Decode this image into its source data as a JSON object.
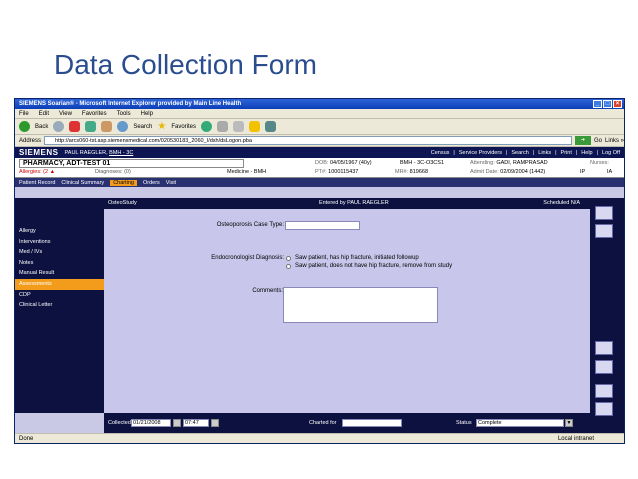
{
  "slide": {
    "title": "Data Collection Form"
  },
  "window": {
    "title": "SIEMENS Soarian® - Microsoft Internet Explorer provided by Main Line Health",
    "menu": [
      "File",
      "Edit",
      "View",
      "Favorites",
      "Tools",
      "Help"
    ],
    "toolbar": {
      "back": "Back",
      "search": "Search",
      "favorites": "Favorites"
    },
    "address_label": "Address",
    "address_url": "http://arcs060-tst.asp.siemensmedical.com/020530183_2060_I/dsh/dsLogon.pba",
    "go": "Go",
    "links": "Links »",
    "status_done": "Done",
    "status_zone": "Local intranet"
  },
  "app": {
    "logo": "SIEMENS",
    "user": "PAUL RAEGLER,",
    "user_link": "BMH - 3C",
    "top_links": [
      "Census",
      "Service Providers",
      "Search",
      "Links",
      "Print",
      "Help",
      "Log Off"
    ],
    "patient": {
      "name": "PHARMACY, ADT-TEST 01",
      "allergies_label": "Allergies:",
      "allergies_value": "(2",
      "diagnoses_label": "Diagnoses:",
      "diagnoses_value": "(0)",
      "unit": "Medicine - BMH",
      "dob_label": "DOB:",
      "dob": "04/05/1967 (40y)",
      "sex_loc": "BMH - 3C-O3CS1",
      "attending_label": "Attending:",
      "attending": "GADI, RAMPRASAD",
      "nurses_label": "Nurses:",
      "pt_label": "PT#:",
      "pt": "1000115437",
      "mr_label": "MR#:",
      "mr": "819668",
      "admit_label": "Admit Date:",
      "admit": "02/09/2004 (1442)",
      "ip": "IP",
      "ia": "IA"
    },
    "tabs": [
      "Patient Record",
      "Clinical Summary",
      "Charting",
      "Orders",
      "Visit"
    ],
    "active_tab": "Charting",
    "sidebar": [
      "Allergy",
      "Interventions",
      "Med / IVs",
      "Notes",
      "Manual Result",
      "Assessments",
      "CDP",
      "Clinical Letter"
    ],
    "active_sidebar": "Assessments",
    "form": {
      "name": "OsteoStudy",
      "entered_by": "Entered by  PAUL RAEGLER",
      "scheduled": "Scheduled  N/A",
      "case_type_label": "Osteoporosis Case Type:",
      "case_type_value": "",
      "endo_label": "Endocronologist Diagnosis:",
      "endo_options": [
        "Saw patient, has hip fracture, initiated followup",
        "Saw patient, does not have hip fracture, remove from study"
      ],
      "comments_label": "Comments:",
      "comments_value": ""
    },
    "footer": {
      "collected_label": "Collected",
      "collected_date": "01/21/2008",
      "collected_time": "07:47",
      "charted_for_label": "Charted for",
      "charted_for_value": "",
      "status_label": "Status",
      "status_value": "Complete"
    }
  }
}
